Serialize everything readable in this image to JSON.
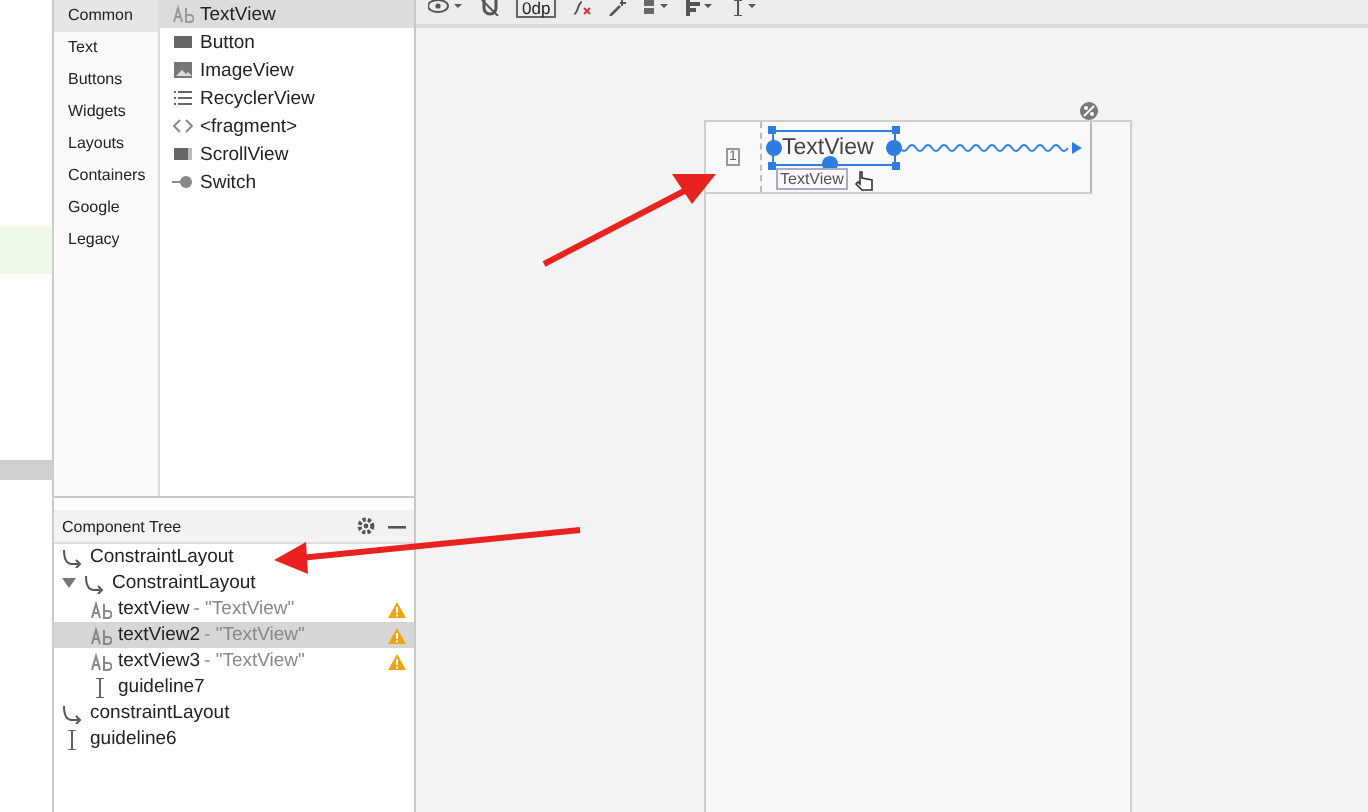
{
  "palette": {
    "categories": [
      {
        "label": "Common",
        "selected": true
      },
      {
        "label": "Text",
        "selected": false
      },
      {
        "label": "Buttons",
        "selected": false
      },
      {
        "label": "Widgets",
        "selected": false
      },
      {
        "label": "Layouts",
        "selected": false
      },
      {
        "label": "Containers",
        "selected": false
      },
      {
        "label": "Google",
        "selected": false
      },
      {
        "label": "Legacy",
        "selected": false
      }
    ],
    "items": [
      {
        "label": "TextView",
        "kind": "text"
      },
      {
        "label": "Button",
        "kind": "button"
      },
      {
        "label": "ImageView",
        "kind": "image"
      },
      {
        "label": "RecyclerView",
        "kind": "list"
      },
      {
        "label": "<fragment>",
        "kind": "fragment"
      },
      {
        "label": "ScrollView",
        "kind": "scroll"
      },
      {
        "label": "Switch",
        "kind": "switch"
      }
    ]
  },
  "toolbar": {
    "margin": "0dp"
  },
  "component_tree": {
    "title": "Component Tree",
    "nodes": [
      {
        "name": "ConstraintLayout",
        "kind": "layout",
        "selected": false,
        "warning": false
      },
      {
        "name": "ConstraintLayout",
        "kind": "layout",
        "selected": false,
        "warning": false,
        "expanded": true,
        "children": [
          {
            "name": "textView",
            "detail": "- \"TextView\"",
            "kind": "text",
            "selected": false,
            "warning": true
          },
          {
            "name": "textView2",
            "detail": "- \"TextView\"",
            "kind": "text",
            "selected": true,
            "warning": true
          },
          {
            "name": "textView3",
            "detail": "- \"TextView\"",
            "kind": "text",
            "selected": false,
            "warning": true
          },
          {
            "name": "guideline7",
            "kind": "guideline",
            "selected": false,
            "warning": false
          }
        ]
      },
      {
        "name": "constraintLayout",
        "kind": "layout",
        "selected": false,
        "warning": false
      },
      {
        "name": "guideline6",
        "kind": "guideline",
        "selected": false,
        "warning": false
      }
    ]
  },
  "design": {
    "guideline_label": "1",
    "widget_text": "TextView",
    "widget_tag": "TextView"
  }
}
